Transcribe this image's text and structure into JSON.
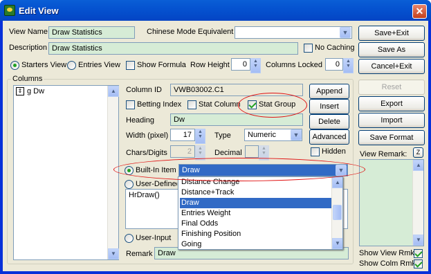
{
  "window": {
    "title": "Edit View",
    "close_label": "✕"
  },
  "top": {
    "view_name_label": "View Name",
    "view_name_value": "Draw Statistics",
    "chinese_label": "Chinese Mode Equivalent",
    "chinese_value": "",
    "description_label": "Description",
    "description_value": "Draw Statistics",
    "no_caching_label": "No Caching",
    "starters_view_label": "Starters View",
    "entries_view_label": "Entries View",
    "show_formula_label": "Show Formula",
    "row_height_label": "Row Height",
    "row_height_value": "0",
    "columns_locked_label": "Columns Locked",
    "columns_locked_value": "0"
  },
  "right_buttons": {
    "save_exit": "Save+Exit",
    "save_as": "Save As",
    "cancel_exit": "Cancel+Exit",
    "reset": "Reset",
    "export": "Export",
    "import": "Import",
    "save_format": "Save Format"
  },
  "view_remark": {
    "label": "View Remark:",
    "z_label": "Z",
    "show_view_rmk": "Show View Rmk",
    "show_colm_rmk": "Show Colm Rmk"
  },
  "columns": {
    "group_label": "Columns",
    "items": [
      "g Dw"
    ],
    "column_id_label": "Column ID",
    "column_id_value": "VWB03002.C1",
    "betting_index_label": "Betting Index",
    "stat_column_label": "Stat Column",
    "stat_group_label": "Stat Group",
    "heading_label": "Heading",
    "heading_value": "Dw",
    "width_label": "Width (pixel)",
    "width_value": "17",
    "type_label": "Type",
    "type_value": "Numeric",
    "chars_label": "Chars/Digits",
    "chars_value": "2",
    "decimal_label": "Decimal",
    "decimal_value": "",
    "hidden_label": "Hidden",
    "builtin_label": "Built-In Item",
    "builtin_value": "Draw",
    "user_defined_label": "User-Defined",
    "formula_value": "HrDraw()",
    "user_input_label": "User-Input",
    "remark_label": "Remark",
    "remark_value": "Draw",
    "append_label": "Append",
    "insert_label": "Insert",
    "delete_label": "Delete",
    "advanced_label": "Advanced"
  },
  "dropdown": {
    "items": [
      "Distance Change",
      "Distance+Track",
      "Draw",
      "Entries Weight",
      "Final Odds",
      "Finishing Position",
      "Going"
    ],
    "selected": "Draw"
  },
  "colors": {
    "accent_green": "#21a121",
    "field_bg": "#d6ecd6",
    "highlight": "#316ac5",
    "annotation": "#e01010"
  }
}
